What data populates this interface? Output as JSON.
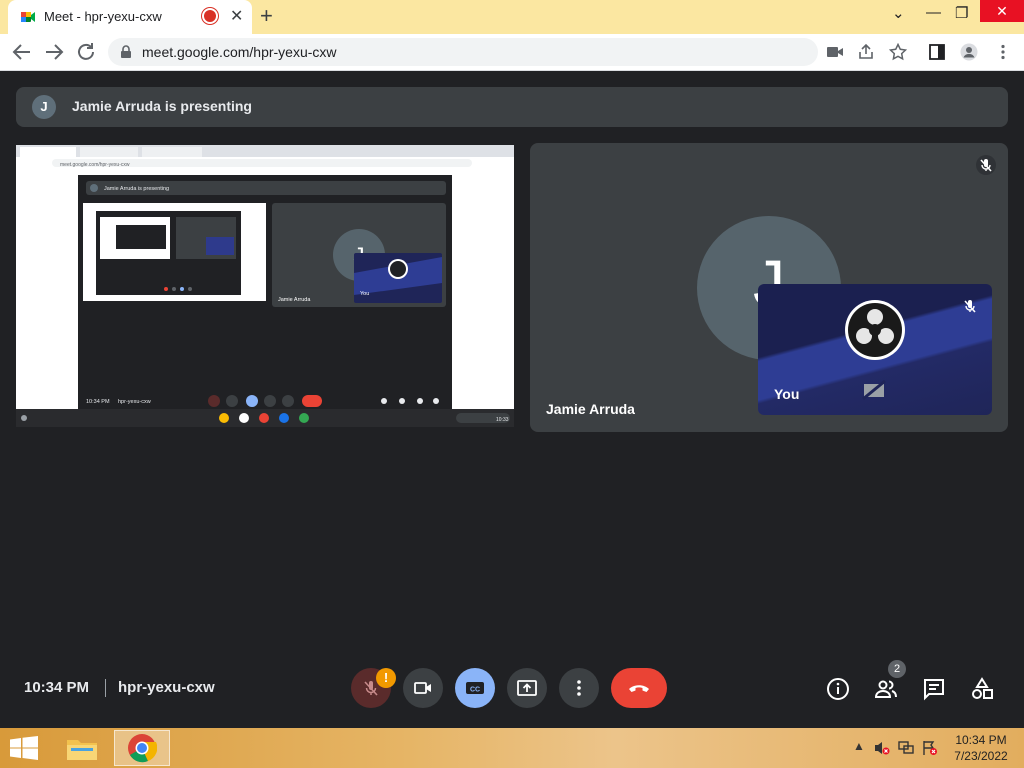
{
  "browser": {
    "tab_title": "Meet - hpr-yexu-cxw",
    "new_tab": "+",
    "tab_close": "✕",
    "url": "meet.google.com/hpr-yexu-cxw",
    "win_minimize": "⌄",
    "win_min": "—",
    "win_restore": "❐",
    "win_close": "✕"
  },
  "banner": {
    "initial": "J",
    "text": "Jamie Arruda is presenting"
  },
  "participant": {
    "initial": "J",
    "name": "Jamie Arruda"
  },
  "self_view": {
    "label": "You"
  },
  "meeting": {
    "time": "10:34 PM",
    "code": "hpr-yexu-cxw",
    "mic_warning": "!",
    "participant_count": "2"
  },
  "screenshare": {
    "inner_banner": "Jamie Arruda is presenting",
    "inner_url": "meet.google.com/hpr-yexu-cxw",
    "inner_time": "10:34 PM",
    "inner_code": "hpr-yexu-cxw",
    "inner_name": "Jamie Arruda",
    "inner_you": "You",
    "inner_clock": "10:33"
  },
  "taskbar": {
    "time": "10:34 PM",
    "date": "7/23/2022",
    "tray_chevron": "▲"
  },
  "colors": {
    "meet_bg": "#202124",
    "tile_bg": "#3c4043",
    "hangup": "#ea4335",
    "captions_active": "#8ab4f8",
    "mic_off": "#5a2b2b",
    "warning": "#f29900"
  }
}
